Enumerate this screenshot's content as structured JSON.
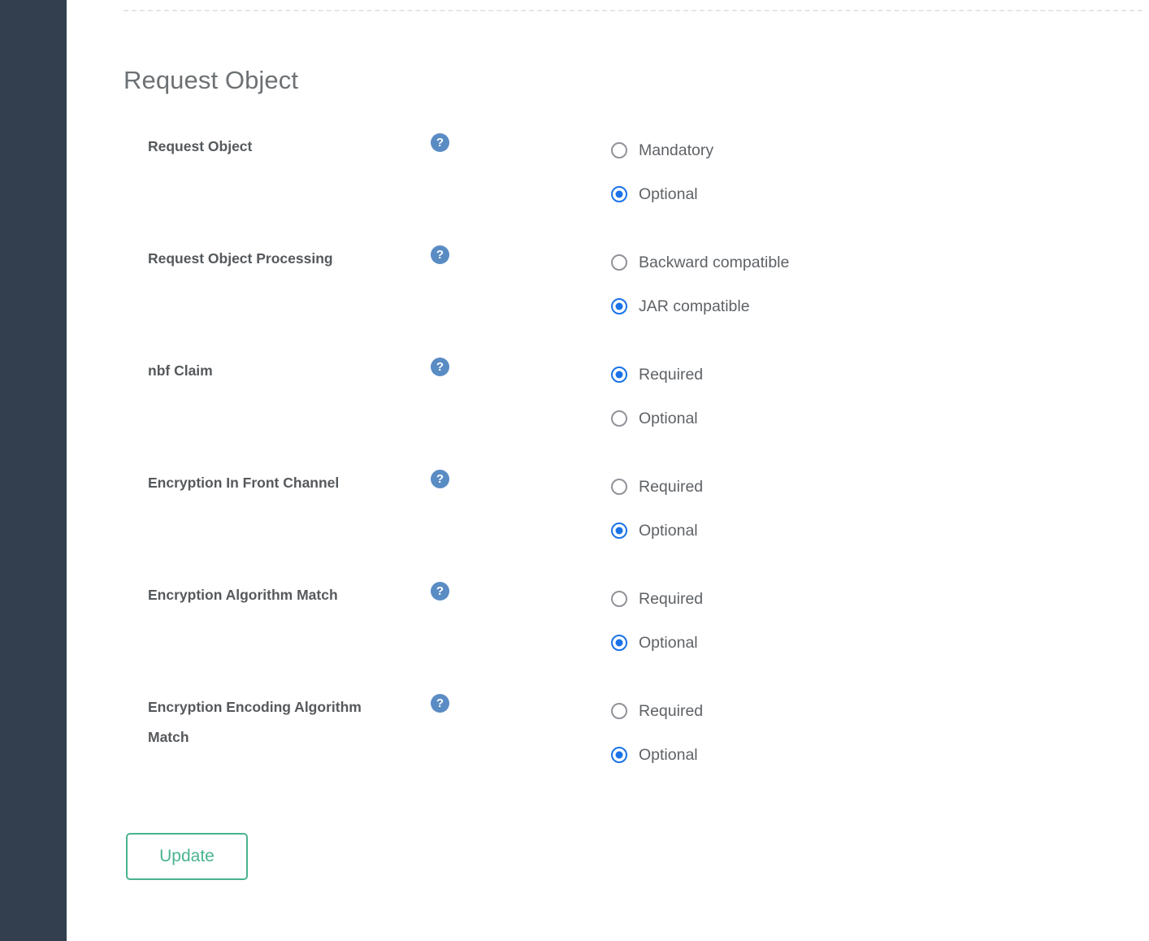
{
  "colors": {
    "sidebar": "#333f4f",
    "title_text": "#6d7174",
    "label_text": "#55595c",
    "option_text": "#5e6266",
    "radio_unselected": "#909398",
    "radio_selected": "#1a73e8",
    "help_icon_bg": "#5a8cc4",
    "button_accent": "#49b391",
    "divider": "#e4e6ea"
  },
  "page": {
    "title": "Request Object"
  },
  "help_icon_glyph": "?",
  "form": {
    "rows": [
      {
        "label": "Request Object",
        "help_icon": "question-mark-icon",
        "options": [
          {
            "label": "Mandatory",
            "selected": false
          },
          {
            "label": "Optional",
            "selected": true
          }
        ]
      },
      {
        "label": "Request Object Processing",
        "help_icon": "question-mark-icon",
        "options": [
          {
            "label": "Backward compatible",
            "selected": false
          },
          {
            "label": "JAR compatible",
            "selected": true
          }
        ]
      },
      {
        "label": "nbf Claim",
        "help_icon": "question-mark-icon",
        "options": [
          {
            "label": "Required",
            "selected": true
          },
          {
            "label": "Optional",
            "selected": false
          }
        ]
      },
      {
        "label": "Encryption In Front Channel",
        "help_icon": "question-mark-icon",
        "options": [
          {
            "label": "Required",
            "selected": false
          },
          {
            "label": "Optional",
            "selected": true
          }
        ]
      },
      {
        "label": "Encryption Algorithm Match",
        "help_icon": "question-mark-icon",
        "options": [
          {
            "label": "Required",
            "selected": false
          },
          {
            "label": "Optional",
            "selected": true
          }
        ]
      },
      {
        "label": "Encryption Encoding Algorithm Match",
        "help_icon": "question-mark-icon",
        "options": [
          {
            "label": "Required",
            "selected": false
          },
          {
            "label": "Optional",
            "selected": true
          }
        ]
      }
    ]
  },
  "actions": {
    "update_label": "Update"
  }
}
